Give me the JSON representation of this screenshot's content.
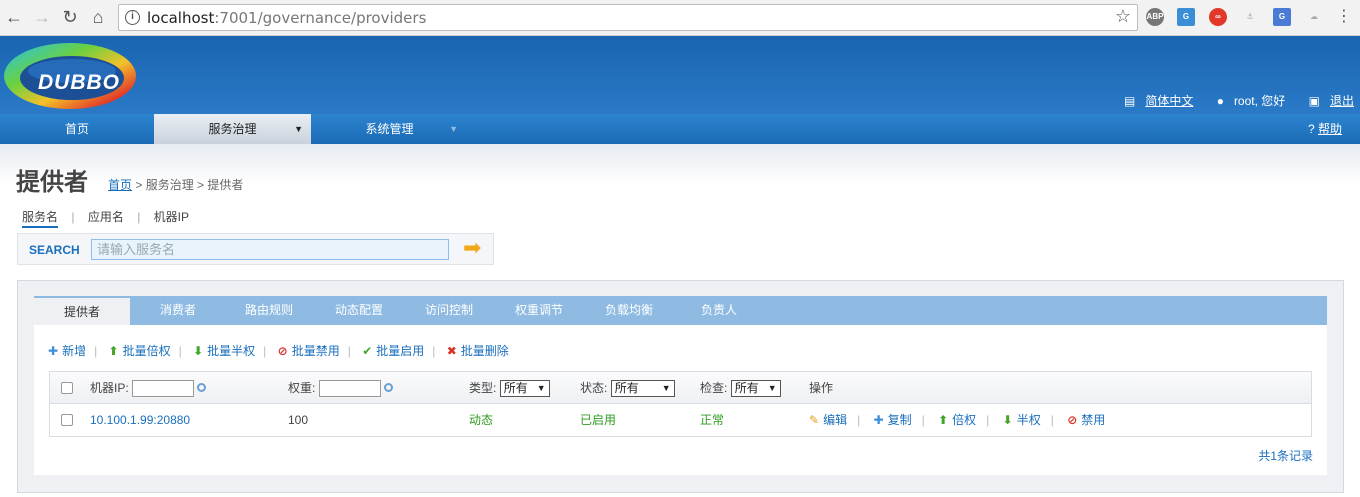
{
  "browser": {
    "url_host": "localhost",
    "url_path": ":7001/governance/providers",
    "extensions": [
      "ABP",
      "G",
      "∞",
      "⚓",
      "G",
      "☁"
    ]
  },
  "header": {
    "logo": "DUBBO",
    "language": "简体中文",
    "user": "root, 您好",
    "logout": "退出"
  },
  "menu": {
    "items": [
      {
        "label": "首页"
      },
      {
        "label": "服务治理",
        "arrow": "▼"
      },
      {
        "label": "系统管理",
        "arrow": "▼"
      }
    ],
    "help": "帮助"
  },
  "page": {
    "title": "提供者",
    "breadcrumb": {
      "home": "首页",
      "rest": " > 服务治理 > 提供者"
    }
  },
  "search": {
    "tabs": [
      "服务名",
      "应用名",
      "机器IP"
    ],
    "seps": [
      "|",
      "|"
    ],
    "label": "SEARCH",
    "placeholder": "请输入服务名"
  },
  "tabs": [
    "提供者",
    "消费者",
    "路由规则",
    "动态配置",
    "访问控制",
    "权重调节",
    "负载均衡",
    "负责人"
  ],
  "toolbar": {
    "add": "新增",
    "double_weight": "批量倍权",
    "half_weight": "批量半权",
    "disable": "批量禁用",
    "enable": "批量启用",
    "delete": "批量删除"
  },
  "table": {
    "headers": {
      "ip": "机器IP:",
      "weight": "权重:",
      "type": "类型:",
      "type_value": "所有",
      "status": "状态:",
      "status_value": "所有",
      "check": "检查:",
      "check_value": "所有",
      "ops": "操作"
    },
    "rows": [
      {
        "ip": "10.100.1.99:20880",
        "weight": "100",
        "type": "动态",
        "status": "已启用",
        "check": "正常",
        "edit": "编辑",
        "copy": "复制",
        "double": "倍权",
        "half": "半权",
        "disable": "禁用"
      }
    ],
    "total": "共1条记录"
  }
}
